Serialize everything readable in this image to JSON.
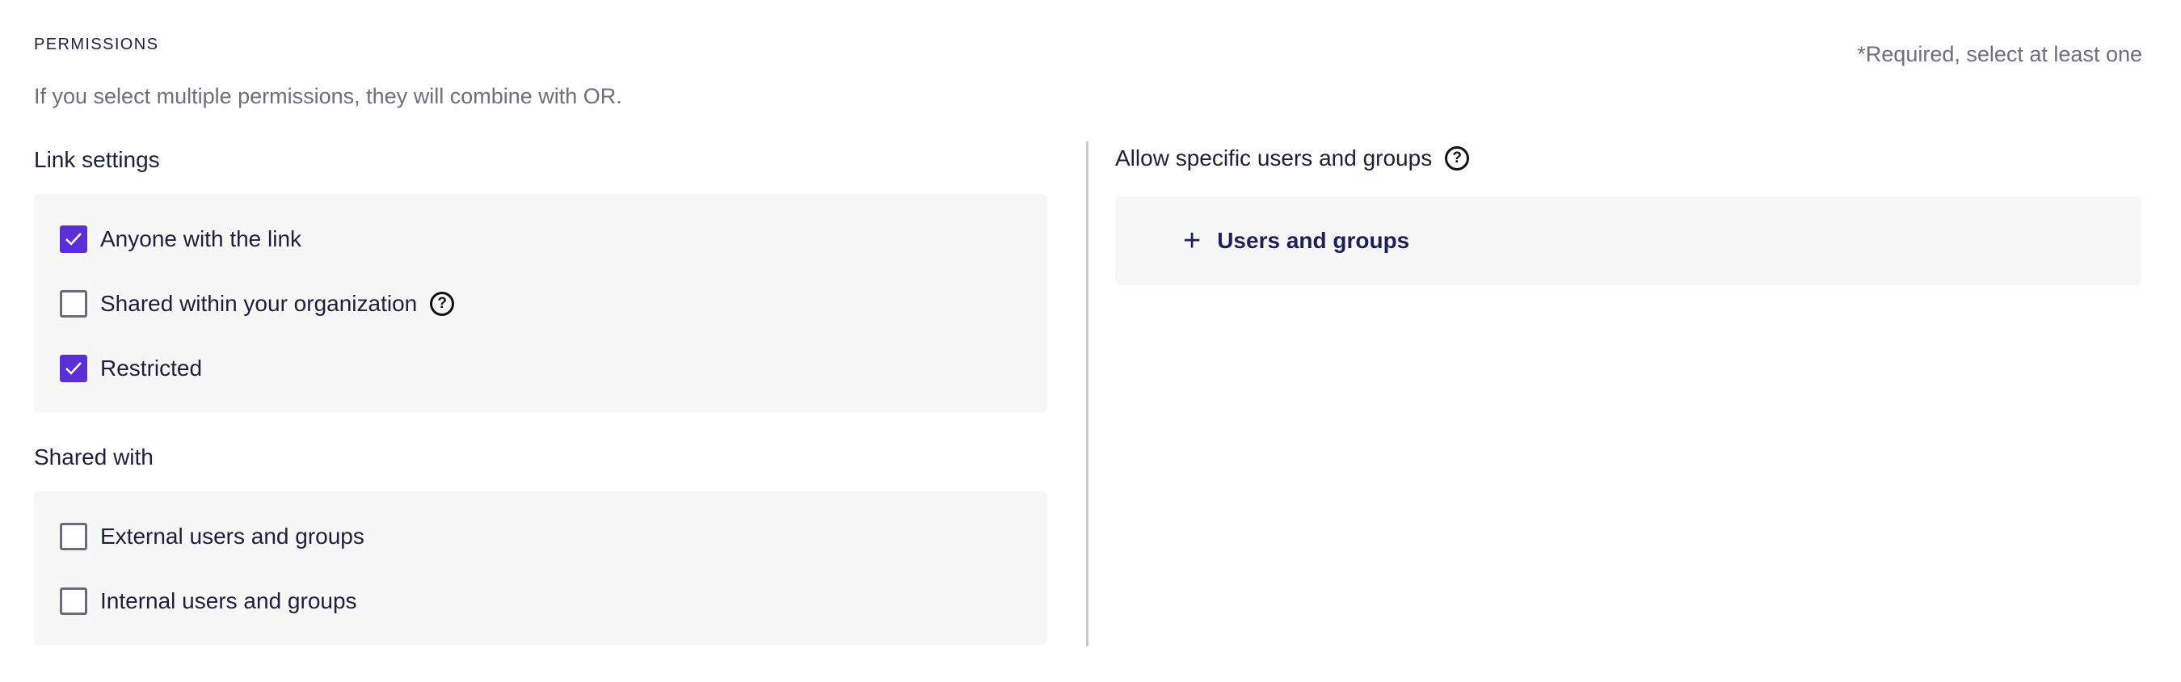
{
  "header": {
    "title": "PERMISSIONS",
    "required_note": "*Required, select at least one",
    "hint": "If you select multiple permissions, they will combine with OR."
  },
  "link_settings": {
    "label": "Link settings",
    "options": [
      {
        "label": "Anyone with the link",
        "checked": true
      },
      {
        "label": "Shared within your organization",
        "checked": false,
        "help_icon": "question-circle-icon"
      },
      {
        "label": "Restricted",
        "checked": true
      }
    ]
  },
  "shared_with": {
    "label": "Shared with",
    "options": [
      {
        "label": "External users and groups",
        "checked": false
      },
      {
        "label": "Internal users and groups",
        "checked": false
      }
    ]
  },
  "allow_specific": {
    "label": "Allow specific users and groups",
    "help_icon": "question-circle-icon",
    "add_button_label": "Users and groups",
    "add_icon": "plus-icon"
  },
  "colors": {
    "accent": "#5b2fd6",
    "panel_bg": "#f7f7f7",
    "muted_text": "#6f6f7a"
  }
}
